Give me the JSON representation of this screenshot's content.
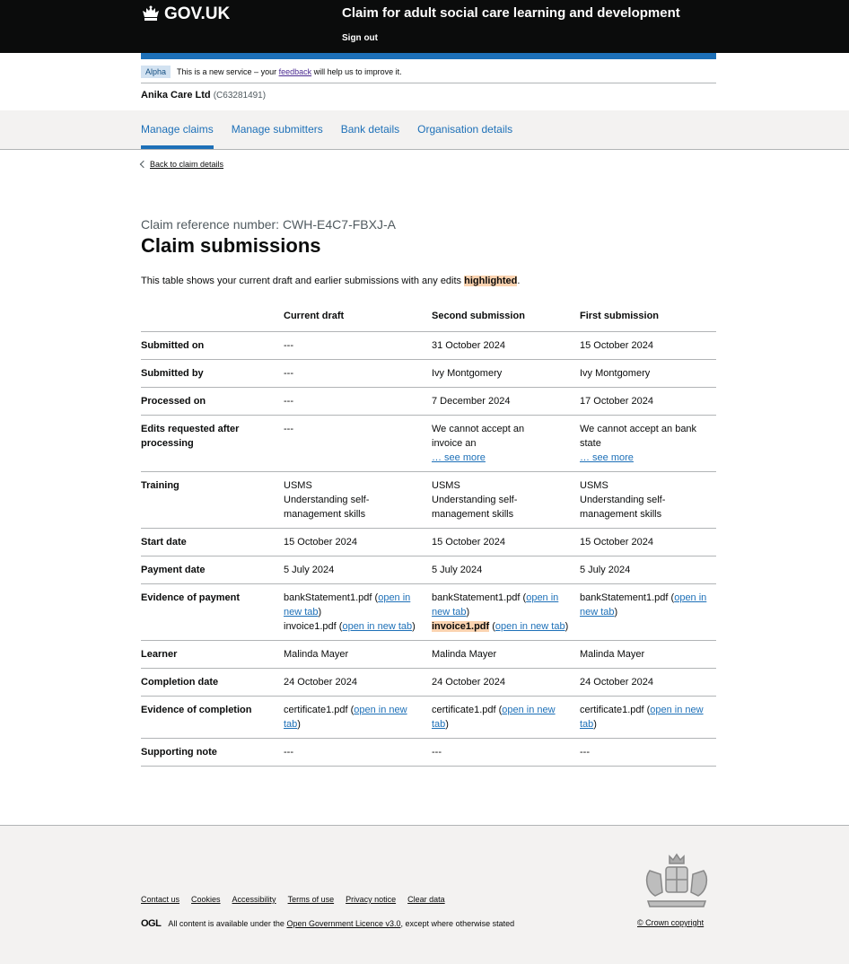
{
  "header": {
    "logo_text": "GOV.UK",
    "service_name": "Claim for adult social care learning and development",
    "sign_out": "Sign out"
  },
  "phase_banner": {
    "tag": "Alpha",
    "text_before": "This is a new service – your",
    "link": "feedback",
    "text_after": "will help us to improve it."
  },
  "organisation": {
    "name": "Anika Care Ltd",
    "reference": "(C63281491)"
  },
  "subnav": {
    "items": [
      {
        "label": "Manage claims"
      },
      {
        "label": "Manage submitters"
      },
      {
        "label": "Bank details"
      },
      {
        "label": "Organisation details"
      }
    ]
  },
  "back_link": "Back to claim details",
  "caption": "Claim reference number: CWH-E4C7-FBXJ-A",
  "title": "Claim submissions",
  "intro": {
    "before": "This table shows your current draft and earlier submissions with any edits",
    "highlight": "highlighted",
    "after": "."
  },
  "table": {
    "headers": [
      "Current draft",
      "Second submission",
      "First submission"
    ],
    "rows": {
      "submitted_on": {
        "label": "Submitted on",
        "c1": "---",
        "c2": "31 October 2024",
        "c3": "15 October 2024"
      },
      "submitted_by": {
        "label": "Submitted by",
        "c1": "---",
        "c2": "Ivy Montgomery",
        "c3": "Ivy Montgomery"
      },
      "processed_on": {
        "label": "Processed on",
        "c1": "---",
        "c2": "7 December 2024",
        "c3": "17 October 2024"
      },
      "edits_requested": {
        "label": "Edits requested after processing",
        "c1": "---",
        "c2": "We cannot accept an invoice an",
        "c2_more": "… see more",
        "c3": "We cannot accept an bank state",
        "c3_more": "… see more"
      },
      "training": {
        "label": "Training",
        "code": "USMS",
        "name": "Understanding self-management skills"
      },
      "start_date": {
        "label": "Start date",
        "c1": "15 October 2024",
        "c2": "15 October 2024",
        "c3": "15 October 2024"
      },
      "payment_date": {
        "label": "Payment date",
        "c1": "5 July 2024",
        "c2": "5 July 2024",
        "c3": "5 July 2024"
      },
      "evidence_payment": {
        "label": "Evidence of payment",
        "file1": "bankStatement1.pdf",
        "file2": "invoice1.pdf",
        "open_link": "open in new tab"
      },
      "learner": {
        "label": "Learner",
        "c1": "Malinda Mayer",
        "c2": "Malinda Mayer",
        "c3": "Malinda Mayer"
      },
      "completion_date": {
        "label": "Completion date",
        "c1": "24 October 2024",
        "c2": "24 October 2024",
        "c3": "24 October 2024"
      },
      "evidence_completion": {
        "label": "Evidence of completion",
        "file": "certificate1.pdf",
        "open_link": "open in new tab"
      },
      "supporting_note": {
        "label": "Supporting note",
        "c1": "---",
        "c2": "---",
        "c3": "---"
      }
    }
  },
  "footer": {
    "links": [
      "Contact us",
      "Cookies",
      "Accessibility",
      "Terms of use",
      "Privacy notice",
      "Clear data"
    ],
    "ogl": "OGL",
    "licence_before": "All content is available under the",
    "licence_link": "Open Government Licence v3.0",
    "licence_after": ", except where otherwise stated",
    "copyright": "© Crown copyright"
  },
  "colors": {
    "header_bg": "#0b0c0c",
    "brand_blue": "#1d70b8",
    "highlight": "#fbd3b0",
    "footer_bg": "#f3f2f1"
  }
}
